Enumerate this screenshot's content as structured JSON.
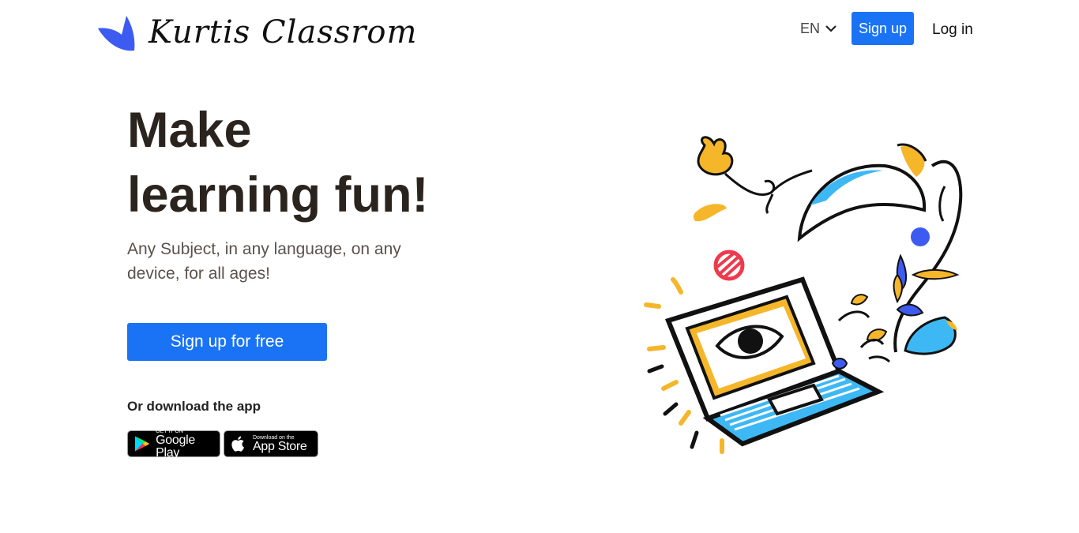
{
  "brand": {
    "name": "Kurtis Classrom",
    "color": "#3d5af1"
  },
  "nav": {
    "language": "EN",
    "signup_label": "Sign up",
    "login_label": "Log in"
  },
  "hero": {
    "title_line1": "Make",
    "title_line2": "learning fun!",
    "subtitle": "Any Subject, in any language, on any device, for all ages!",
    "cta_label": "Sign up for free"
  },
  "download": {
    "label": "Or download the app",
    "google_play": {
      "small": "GET IT ON",
      "big": "Google Play"
    },
    "app_store": {
      "small": "Download on the",
      "big": "App Store"
    }
  },
  "colors": {
    "accent": "#1a73f5",
    "heading": "#2b241e",
    "illustration_yellow": "#f5b62a",
    "illustration_blue": "#3db8f5",
    "illustration_red": "#ee3a4e"
  },
  "icons": [
    "logo-mark-icon",
    "chevron-down-icon",
    "google-play-icon",
    "apple-icon",
    "laptop-eye-illustration"
  ]
}
